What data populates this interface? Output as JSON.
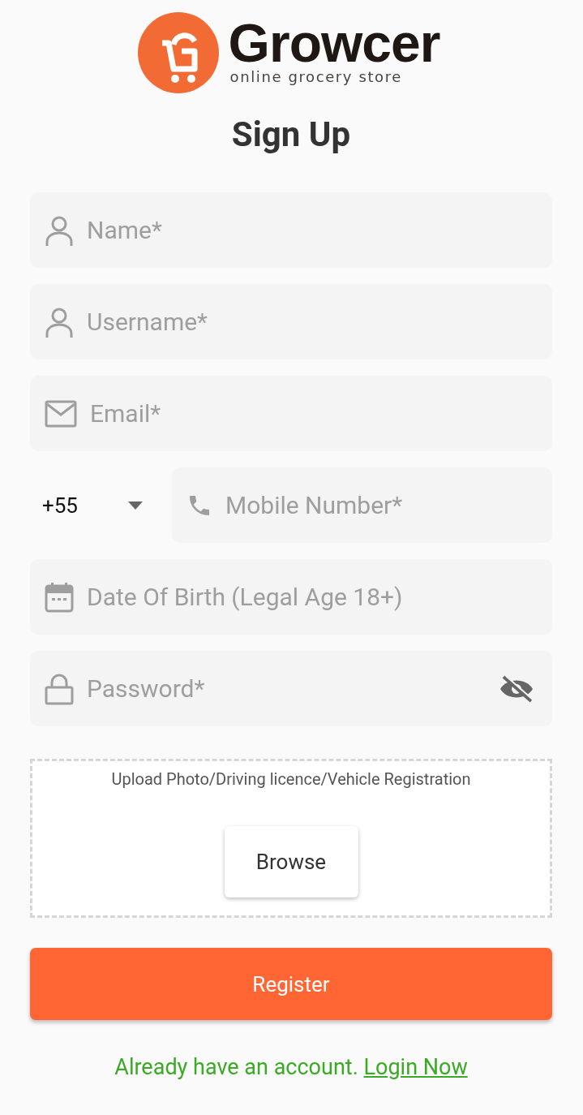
{
  "logo": {
    "name": "Growcer",
    "tagline": "online grocery store"
  },
  "title": "Sign Up",
  "fields": [
    {
      "kind": "person",
      "placeholder": "Name*"
    },
    {
      "kind": "person",
      "placeholder": "Username*"
    },
    {
      "kind": "mail",
      "placeholder": "Email*"
    },
    {
      "kind": "phone",
      "placeholder": "Mobile Number*",
      "country_code": "+55"
    },
    {
      "kind": "calendar",
      "placeholder": "Date Of Birth (Legal Age 18+)"
    },
    {
      "kind": "lock",
      "placeholder": "Password*",
      "password_visible": false
    }
  ],
  "upload": {
    "label": "Upload Photo/Driving licence/Vehicle Registration",
    "button": "Browse"
  },
  "register_button": "Register",
  "footer": {
    "text": "Already have an account.",
    "link": "Login Now"
  }
}
